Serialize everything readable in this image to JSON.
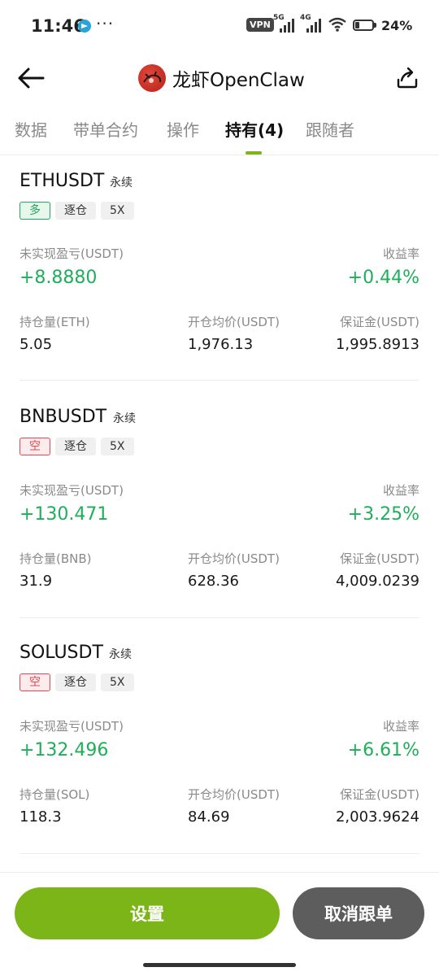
{
  "status_bar": {
    "time": "11:46",
    "dots": "···",
    "vpn": "VPN",
    "net1": "5G",
    "net2": "4G",
    "battery": "24%"
  },
  "header": {
    "title": "龙虾OpenClaw"
  },
  "tabs": [
    {
      "label": "数据"
    },
    {
      "label": "带单合约"
    },
    {
      "label": "操作"
    },
    {
      "label": "持有(4)"
    },
    {
      "label": "跟随者"
    }
  ],
  "positions": [
    {
      "symbol": "ETHUSDT",
      "type": "永续",
      "side": "多",
      "margin_mode": "逐仓",
      "leverage": "5X",
      "pnl_label": "未实现盈亏(USDT)",
      "pnl": "+8.8880",
      "roi_label": "收益率",
      "roi": "+0.44%",
      "size_label": "持仓量(ETH)",
      "size": "5.05",
      "entry_label": "开仓均价(USDT)",
      "entry": "1,976.13",
      "margin_label": "保证金(USDT)",
      "margin": "1,995.8913"
    },
    {
      "symbol": "BNBUSDT",
      "type": "永续",
      "side": "空",
      "margin_mode": "逐仓",
      "leverage": "5X",
      "pnl_label": "未实现盈亏(USDT)",
      "pnl": "+130.471",
      "roi_label": "收益率",
      "roi": "+3.25%",
      "size_label": "持仓量(BNB)",
      "size": "31.9",
      "entry_label": "开仓均价(USDT)",
      "entry": "628.36",
      "margin_label": "保证金(USDT)",
      "margin": "4,009.0239"
    },
    {
      "symbol": "SOLUSDT",
      "type": "永续",
      "side": "空",
      "margin_mode": "逐仓",
      "leverage": "5X",
      "pnl_label": "未实现盈亏(USDT)",
      "pnl": "+132.496",
      "roi_label": "收益率",
      "roi": "+6.61%",
      "size_label": "持仓量(SOL)",
      "size": "118.3",
      "entry_label": "开仓均价(USDT)",
      "entry": "84.69",
      "margin_label": "保证金(USDT)",
      "margin": "2,003.9624"
    }
  ],
  "actions": {
    "settings": "设置",
    "cancel_follow": "取消跟单"
  },
  "colors": {
    "accent_green": "#7cb518",
    "profit_green": "#1fae5a",
    "short_red": "#e0494f",
    "button_gray": "#5d5d5d"
  }
}
